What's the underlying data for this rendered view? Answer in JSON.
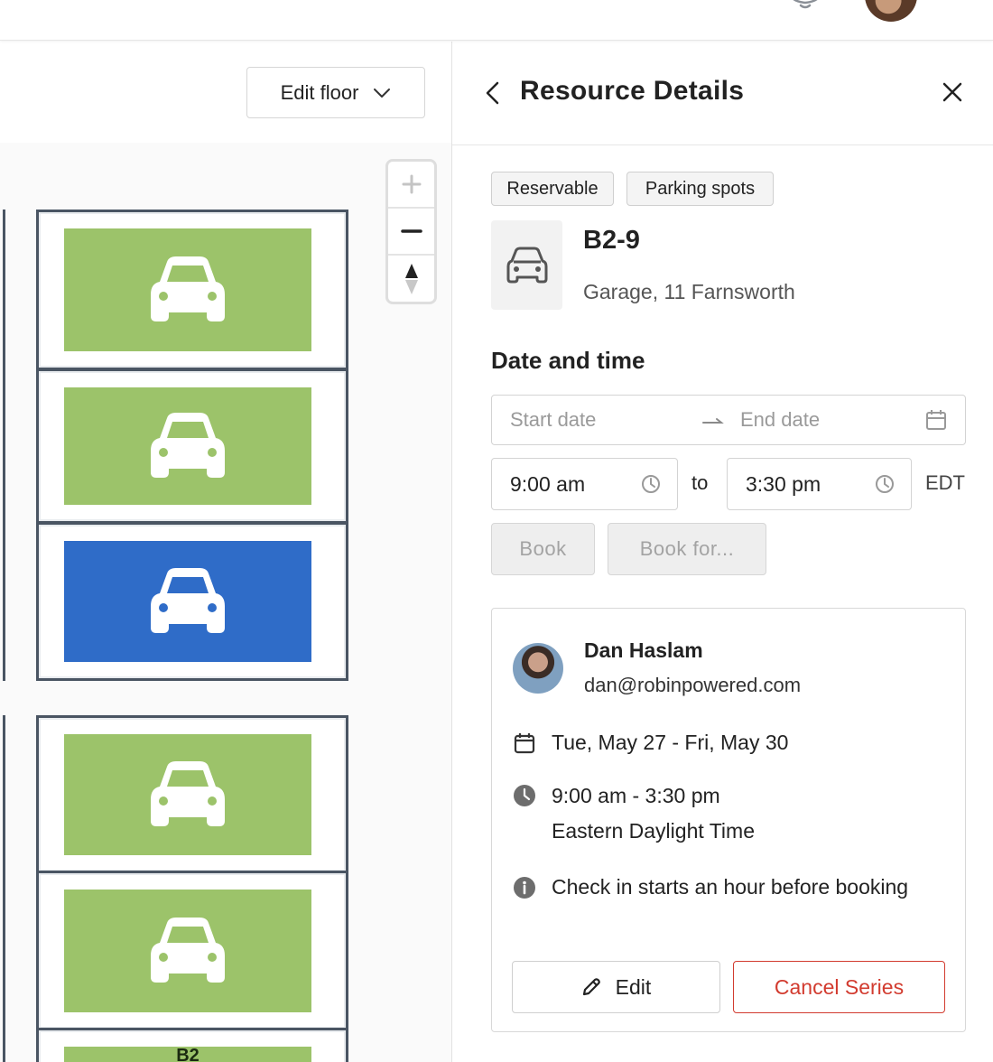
{
  "map": {
    "edit_floor_label": "Edit floor",
    "spots": [
      {
        "status": "available",
        "color": "#9cc36a"
      },
      {
        "status": "available",
        "color": "#9cc36a"
      },
      {
        "status": "selected",
        "color": "#2f6cc8"
      },
      {
        "status": "available",
        "color": "#9cc36a"
      },
      {
        "status": "available",
        "color": "#9cc36a"
      },
      {
        "status": "available",
        "color": "#9cc36a",
        "label": "B2"
      }
    ]
  },
  "panel": {
    "title": "Resource Details",
    "tags": [
      "Reservable",
      "Parking spots"
    ],
    "resource": {
      "icon": "car-icon",
      "name": "B2-9",
      "location": "Garage, 11 Farnsworth"
    },
    "date_time": {
      "section_title": "Date and time",
      "start_placeholder": "Start date",
      "end_placeholder": "End date",
      "start_time": "9:00 am",
      "to_label": "to",
      "end_time": "3:30 pm",
      "timezone": "EDT",
      "book_label": "Book",
      "book_for_label": "Book for..."
    },
    "reservation": {
      "user_name": "Dan Haslam",
      "user_email": "dan@robinpowered.com",
      "dates": "Tue, May 27 - Fri, May 30",
      "time_range": "9:00 am - 3:30 pm",
      "time_zone_name": "Eastern Daylight Time",
      "check_in_info": "Check in starts an hour before booking",
      "edit_label": "Edit",
      "cancel_label": "Cancel Series"
    }
  },
  "colors": {
    "spot_available": "#9cc36a",
    "spot_selected": "#2f6cc8",
    "danger": "#d23b2f"
  }
}
